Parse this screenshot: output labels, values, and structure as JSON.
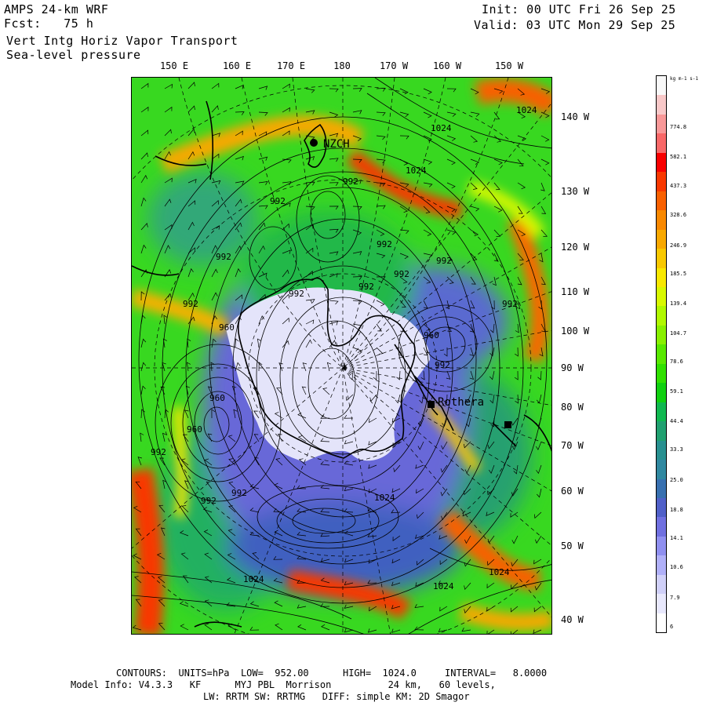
{
  "header": {
    "model": "AMPS 24-km WRF",
    "fcst_label": "Fcst:",
    "fcst_value": "75 h",
    "field": "Vert Intg Horiz Vapor Transport",
    "field2": "Sea-level pressure",
    "init": "Init: 00 UTC Fri 26 Sep 25",
    "valid": "Valid: 03 UTC Mon 29 Sep 25"
  },
  "lon_labels": [
    "150 E",
    "160 E",
    "170 E",
    "180",
    "170 W",
    "160 W",
    "150 W"
  ],
  "lat_labels": [
    "140 W",
    "130 W",
    "120 W",
    "110 W",
    "100 W",
    "90 W",
    "80 W",
    "70 W",
    "60 W",
    "50 W",
    "40 W"
  ],
  "station_labels": [
    "NZCH",
    "Rothera"
  ],
  "contour_labels": [
    "1024",
    "1024",
    "1024",
    "992",
    "992",
    "992",
    "992",
    "992",
    "992",
    "992",
    "992",
    "992",
    "992",
    "960",
    "960",
    "960",
    "960",
    "992",
    "992",
    "992",
    "992",
    "1024",
    "1024",
    "1024",
    "1024"
  ],
  "colorbar": {
    "unit": "kg m-1 s-1",
    "labels": [
      "774.8",
      "582.1",
      "437.3",
      "328.6",
      "246.9",
      "185.5",
      "139.4",
      "104.7",
      "78.6",
      "59.1",
      "44.4",
      "33.3",
      "25.0",
      "18.8",
      "14.1",
      "10.6",
      "7.9",
      "6"
    ],
    "colors": [
      "#f8f8f8",
      "#f8c8c8",
      "#f89898",
      "#f86868",
      "#f80000",
      "#f83800",
      "#f86000",
      "#f88800",
      "#f8a800",
      "#f8c800",
      "#f8e800",
      "#d8f800",
      "#b0f800",
      "#88f000",
      "#58e800",
      "#30e000",
      "#10d010",
      "#10b850",
      "#20a070",
      "#289090",
      "#3088a0",
      "#3870b0",
      "#5060c8",
      "#7070e0",
      "#9090f0",
      "#b0b0f8",
      "#d0d0f8",
      "#e8e8fc",
      "#ffffff"
    ]
  },
  "footer": {
    "line1": "CONTOURS:  UNITS=hPa  LOW=  952.00      HIGH=  1024.0     INTERVAL=   8.0000",
    "line2": "Model Info: V4.3.3   KF      MYJ PBL  Morrison          24 km,   60 levels,",
    "line3": "LW: RRTM SW: RRTMG   DIFF: simple KM: 2D Smagor"
  }
}
